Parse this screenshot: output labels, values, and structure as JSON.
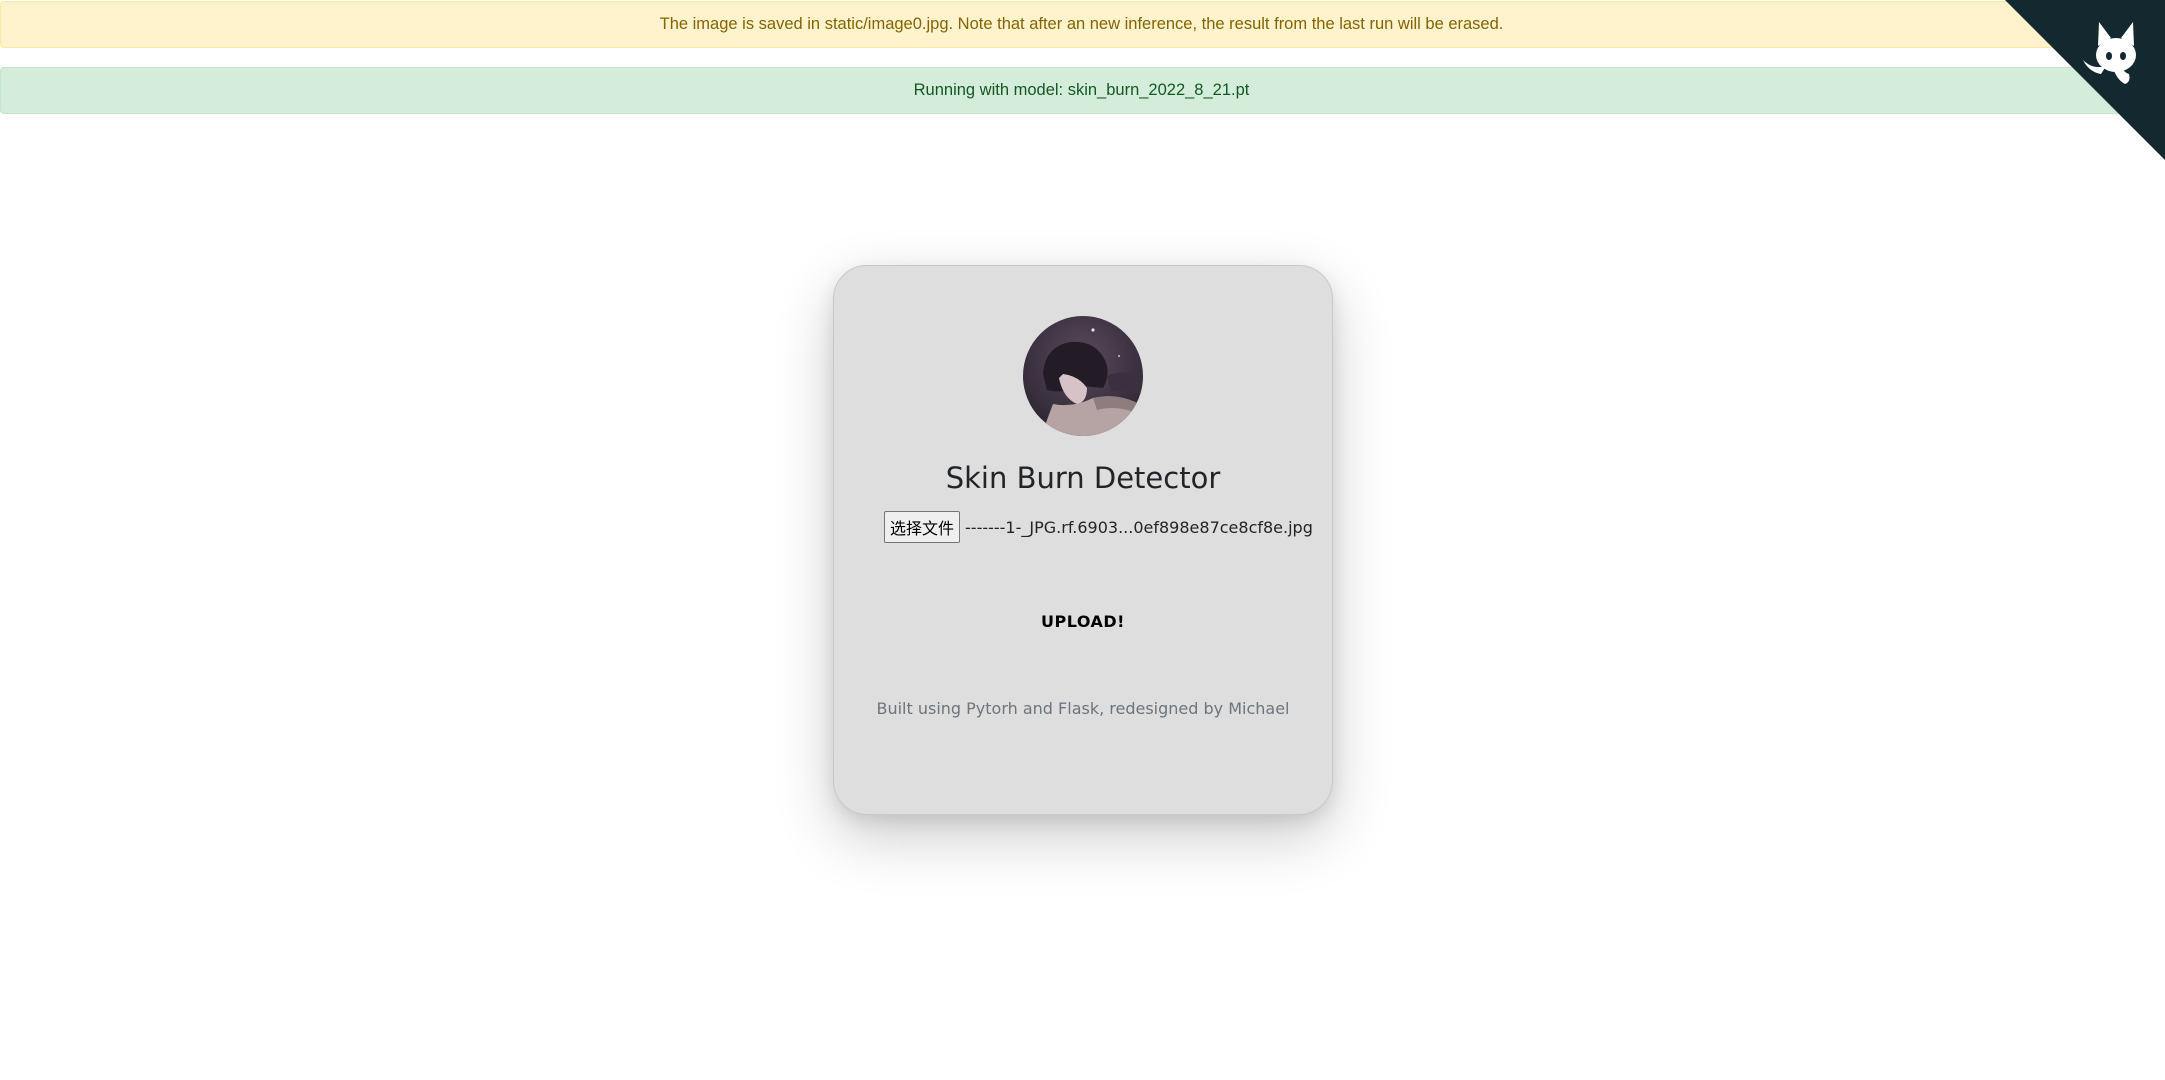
{
  "alerts": {
    "warning_text": "The image is saved in static/image0.jpg. Note that after an new inference, the result from the last run will be erased.",
    "success_text": "Running with model: skin_burn_2022_8_21.pt"
  },
  "corner": {
    "icon": "github-octocat-icon",
    "bg_color": "#14282f"
  },
  "card": {
    "avatar_icon": "avatar-anime-portrait",
    "title": "Skin Burn Detector",
    "file_button_label": "选择文件",
    "file_name": "-------1-_JPG.rf.6903...0ef898e87ce8cf8e.jpg",
    "upload_label": "UPLOAD!",
    "footer_text": "Built using Pytorh and Flask, redesigned by Michael"
  }
}
